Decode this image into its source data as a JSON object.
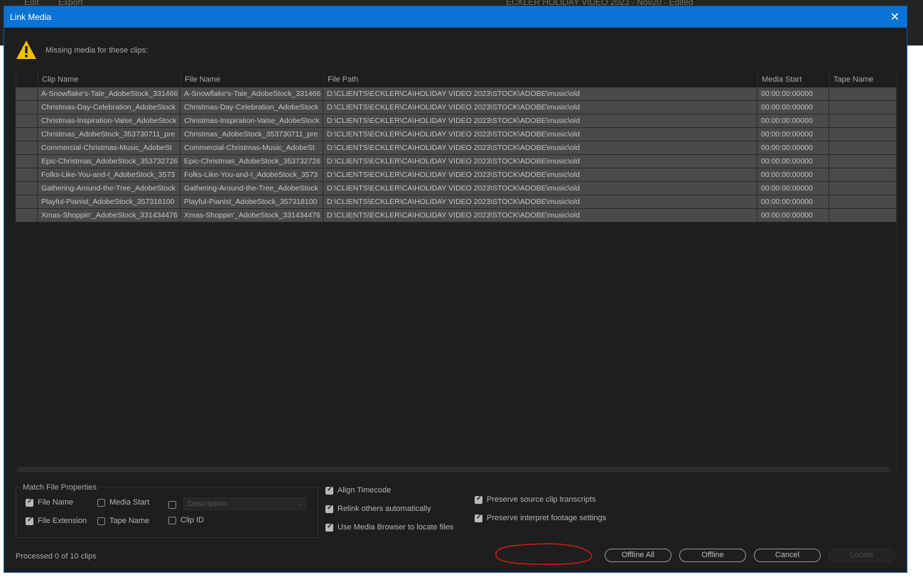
{
  "background_app": {
    "menu": [
      "Edit",
      "Export"
    ],
    "title": "ECKLER HOLIDAY VIDEO 2023 - Nov20 - Edited"
  },
  "dialog": {
    "title": "Link Media",
    "close_glyph": "✕",
    "warning_icon": "warning-triangle-icon",
    "message": "Missing media for these clips:"
  },
  "table": {
    "columns": [
      "",
      "Clip Name",
      "File Name",
      "File Path",
      "Media Start",
      "Tape Name"
    ],
    "rows": [
      {
        "clip": "A-Snowflake's-Tale_AdobeStock_331466",
        "file": "A-Snowflake's-Tale_AdobeStock_331466",
        "path": "D:\\CLIENTS\\ECKLER\\CA\\HOLIDAY VIDEO 2023\\STOCK\\ADOBE\\music\\old",
        "start": "00:00:00:00000",
        "tape": ""
      },
      {
        "clip": "Christmas-Day-Celebration_AdobeStock",
        "file": "Christmas-Day-Celebration_AdobeStock",
        "path": "D:\\CLIENTS\\ECKLER\\CA\\HOLIDAY VIDEO 2023\\STOCK\\ADOBE\\music\\old",
        "start": "00:00:00:00000",
        "tape": ""
      },
      {
        "clip": "Christmas-Inspiration-Valse_AdobeStock",
        "file": "Christmas-Inspiration-Valse_AdobeStock",
        "path": "D:\\CLIENTS\\ECKLER\\CA\\HOLIDAY VIDEO 2023\\STOCK\\ADOBE\\music\\old",
        "start": "00:00:00:00000",
        "tape": ""
      },
      {
        "clip": "Christmas_AdobeStock_353730711_pre",
        "file": "Christmas_AdobeStock_353730711_pre",
        "path": "D:\\CLIENTS\\ECKLER\\CA\\HOLIDAY VIDEO 2023\\STOCK\\ADOBE\\music\\old",
        "start": "00:00:00:00000",
        "tape": ""
      },
      {
        "clip": "Commercial-Christmas-Music_AdobeSt",
        "file": "Commercial-Christmas-Music_AdobeSt",
        "path": "D:\\CLIENTS\\ECKLER\\CA\\HOLIDAY VIDEO 2023\\STOCK\\ADOBE\\music\\old",
        "start": "00:00:00:00000",
        "tape": ""
      },
      {
        "clip": "Epic-Christmas_AdobeStock_353732726",
        "file": "Epic-Christmas_AdobeStock_353732726",
        "path": "D:\\CLIENTS\\ECKLER\\CA\\HOLIDAY VIDEO 2023\\STOCK\\ADOBE\\music\\old",
        "start": "00:00:00:00000",
        "tape": ""
      },
      {
        "clip": "Folks-Like-You-and-I_AdobeStock_3573",
        "file": "Folks-Like-You-and-I_AdobeStock_3573",
        "path": "D:\\CLIENTS\\ECKLER\\CA\\HOLIDAY VIDEO 2023\\STOCK\\ADOBE\\music\\old",
        "start": "00:00:00:00000",
        "tape": ""
      },
      {
        "clip": "Gathering-Around-the-Tree_AdobeStock",
        "file": "Gathering-Around-the-Tree_AdobeStock",
        "path": "D:\\CLIENTS\\ECKLER\\CA\\HOLIDAY VIDEO 2023\\STOCK\\ADOBE\\music\\old",
        "start": "00:00:00:00000",
        "tape": ""
      },
      {
        "clip": "Playful-Pianist_AdobeStock_357318100",
        "file": "Playful-Pianist_AdobeStock_357318100",
        "path": "D:\\CLIENTS\\ECKLER\\CA\\HOLIDAY VIDEO 2023\\STOCK\\ADOBE\\music\\old",
        "start": "00:00:00:00000",
        "tape": ""
      },
      {
        "clip": "Xmas-Shoppin'_AdobeStock_331434476",
        "file": "Xmas-Shoppin'_AdobeStock_331434476",
        "path": "D:\\CLIENTS\\ECKLER\\CA\\HOLIDAY VIDEO 2023\\STOCK\\ADOBE\\music\\old",
        "start": "00:00:00:00000",
        "tape": ""
      }
    ]
  },
  "match_props": {
    "legend": "Match File Properties",
    "file_name": {
      "label": "File Name",
      "checked": true
    },
    "media_start": {
      "label": "Media Start",
      "checked": false
    },
    "description": {
      "placeholder": "Description",
      "checked": false
    },
    "file_extension": {
      "label": "File Extension",
      "checked": true
    },
    "tape_name": {
      "label": "Tape Name",
      "checked": false
    },
    "clip_id": {
      "label": "Clip ID",
      "checked": false
    }
  },
  "options": {
    "align_timecode": {
      "label": "Align Timecode",
      "checked": true
    },
    "relink_others": {
      "label": "Relink others automatically",
      "checked": true
    },
    "media_browser": {
      "label": "Use Media Browser to locate files",
      "checked": true
    },
    "preserve_transcripts": {
      "label": "Preserve source clip transcripts",
      "checked": true
    },
    "preserve_interpret": {
      "label": "Preserve interpret footage settings",
      "checked": true
    }
  },
  "status": "Processed 0 of 10 clips",
  "buttons": {
    "offline_all": "Offline All",
    "offline": "Offline",
    "cancel": "Cancel",
    "locate": "Locate"
  },
  "colors": {
    "titlebar": "#0a74d6",
    "dialog_bg": "#1e1e1e",
    "row_bg": "#4a4a4a",
    "annotation": "#d11a1a"
  }
}
